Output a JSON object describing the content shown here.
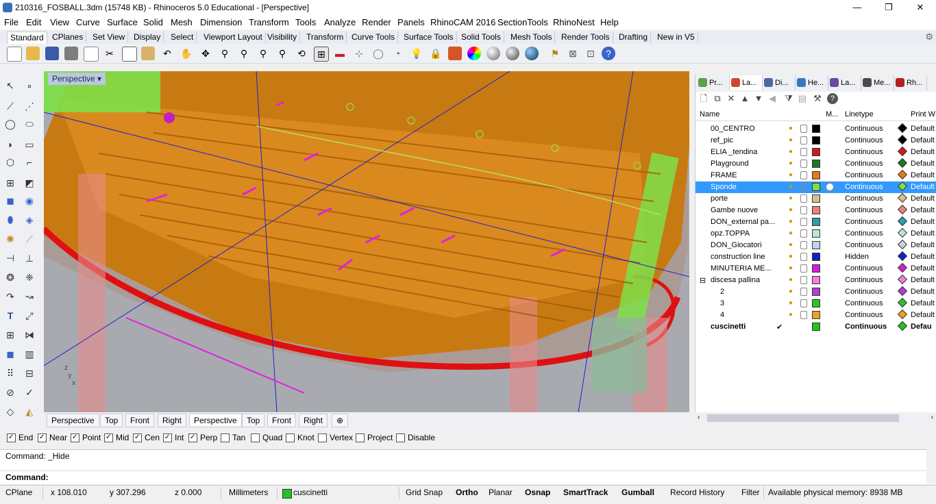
{
  "window": {
    "title": "210316_FOSBALL.3dm (15748 KB) - Rhinoceros 5.0 Educational - [Perspective]",
    "minimize": "—",
    "restore": "❐",
    "close": "✕"
  },
  "menu": [
    "File",
    "Edit",
    "View",
    "Curve",
    "Surface",
    "Solid",
    "Mesh",
    "Dimension",
    "Transform",
    "Tools",
    "Analyze",
    "Render",
    "Panels",
    "RhinoCAM 2016",
    "SectionTools",
    "RhinoNest",
    "Help"
  ],
  "toolbar_tabs": [
    "Standard",
    "CPlanes",
    "Set View",
    "Display",
    "Select",
    "Viewport Layout",
    "Visibility",
    "Transform",
    "Curve Tools",
    "Surface Tools",
    "Solid Tools",
    "Mesh Tools",
    "Render Tools",
    "Drafting",
    "New in V5"
  ],
  "toolbar_icons": [
    "new-icon",
    "open-icon",
    "save-icon",
    "print-icon",
    "import-icon",
    "cut-icon",
    "copy-icon",
    "paste-icon",
    "undo-icon",
    "pan-icon",
    "rotate-view-icon",
    "zoom-dynamic-icon",
    "zoom-window-icon",
    "zoom-extents-icon",
    "zoom-selected-icon",
    "rotate-icon",
    "four-views-icon",
    "car-icon",
    "grid-icon",
    "circle-icon",
    "light-icon",
    "lock-icon",
    "layer-icon",
    "color-wheel-icon",
    "shade-icon",
    "render-sphere-icon",
    "rendered-icon",
    "move-icon",
    "osnap-icon",
    "snap-icon",
    "help-icon"
  ],
  "viewport": {
    "label": "Perspective",
    "dropdown": "▾",
    "tabs": [
      "Perspective",
      "Top",
      "Front",
      "Right",
      "Perspective",
      "Top",
      "Front",
      "Right"
    ],
    "active_tab": 4,
    "add": "⊕"
  },
  "osnap": [
    {
      "label": "End",
      "checked": true
    },
    {
      "label": "Near",
      "checked": true
    },
    {
      "label": "Point",
      "checked": true
    },
    {
      "label": "Mid",
      "checked": true
    },
    {
      "label": "Cen",
      "checked": true
    },
    {
      "label": "Int",
      "checked": true
    },
    {
      "label": "Perp",
      "checked": true
    },
    {
      "label": "Tan",
      "checked": false
    },
    {
      "label": "Quad",
      "checked": false
    },
    {
      "label": "Knot",
      "checked": false
    },
    {
      "label": "Vertex",
      "checked": false
    },
    {
      "label": "Project",
      "checked": false
    },
    {
      "label": "Disable",
      "checked": false
    }
  ],
  "command": {
    "history": "Command: _Hide",
    "prompt": "Command:"
  },
  "status": {
    "cplane": "CPlane",
    "x": "x 108.010",
    "y": "y 307.296",
    "z": "z 0.000",
    "units": "Millimeters",
    "layer": "cuscinetti",
    "layer_color": "#22c322",
    "toggles": [
      {
        "label": "Grid Snap",
        "bold": false
      },
      {
        "label": "Ortho",
        "bold": true
      },
      {
        "label": "Planar",
        "bold": false
      },
      {
        "label": "Osnap",
        "bold": true
      },
      {
        "label": "SmartTrack",
        "bold": true
      },
      {
        "label": "Gumball",
        "bold": true
      },
      {
        "label": "Record History",
        "bold": false
      },
      {
        "label": "Filter",
        "bold": false
      }
    ],
    "memory": "Available physical memory: 8938 MB"
  },
  "panel": {
    "tabs": [
      {
        "label": "Pr...",
        "color": "#5ca04a"
      },
      {
        "label": "La...",
        "color": "#d0452e"
      },
      {
        "label": "Di...",
        "color": "#4a6aa3"
      },
      {
        "label": "He...",
        "color": "#3a76c4"
      },
      {
        "label": "La...",
        "color": "#6a4aa3"
      },
      {
        "label": "Me...",
        "color": "#4a4a4a"
      },
      {
        "label": "Rh...",
        "color": "#b22020"
      }
    ],
    "active_tab": 1,
    "layer_tools": [
      "new-layer-icon",
      "new-sublayer-icon",
      "delete-icon",
      "move-up-icon",
      "move-down-icon",
      "move-left-icon",
      "filter-icon",
      "copy-layer-icon",
      "tools-icon",
      "help-icon"
    ],
    "columns": {
      "name": "Name",
      "material": "M...",
      "linetype": "Linetype",
      "print": "Print W"
    },
    "layers": [
      {
        "name": "00_CENTRO",
        "color": "#000000",
        "linetype": "Continuous",
        "print": "Default"
      },
      {
        "name": "ref_pic",
        "color": "#000000",
        "linetype": "Continuous",
        "print": "Default"
      },
      {
        "name": "ELIA _tendina",
        "color": "#d11a1a",
        "linetype": "Continuous",
        "print": "Default"
      },
      {
        "name": "Playground",
        "color": "#1f7a1f",
        "linetype": "Continuous",
        "print": "Default"
      },
      {
        "name": "FRAME",
        "color": "#e07a20",
        "linetype": "Continuous",
        "print": "Default"
      },
      {
        "name": "Sponde",
        "color": "#7ee04a",
        "linetype": "Continuous",
        "print": "Default",
        "selected": true
      },
      {
        "name": "porte",
        "color": "#d8c08a",
        "linetype": "Continuous",
        "print": "Default"
      },
      {
        "name": "Gambe nuove",
        "color": "#e88080",
        "linetype": "Continuous",
        "print": "Default"
      },
      {
        "name": "DON_external pa...",
        "color": "#2a9fa8",
        "linetype": "Continuous",
        "print": "Default"
      },
      {
        "name": "opz.TOPPA",
        "color": "#b8e8c8",
        "linetype": "Continuous",
        "print": "Default"
      },
      {
        "name": "DON_Giocatori",
        "color": "#c8d0e8",
        "linetype": "Continuous",
        "print": "Default"
      },
      {
        "name": "construction line",
        "color": "#1020c8",
        "linetype": "Hidden",
        "print": "Default"
      },
      {
        "name": "MINUTERIA ME...",
        "color": "#d020d0",
        "linetype": "Continuous",
        "print": "Default"
      },
      {
        "name": "discesa pallina",
        "color": "#f080e0",
        "linetype": "Continuous",
        "print": "Default",
        "expand": "⊟"
      },
      {
        "name": "2",
        "color": "#b040d0",
        "linetype": "Continuous",
        "print": "Default",
        "indent": true
      },
      {
        "name": "3",
        "color": "#30c030",
        "linetype": "Continuous",
        "print": "Default",
        "indent": true
      },
      {
        "name": "4",
        "color": "#f0a020",
        "linetype": "Continuous",
        "print": "Default",
        "indent": true
      },
      {
        "name": "cuscinetti",
        "color": "#22c322",
        "linetype": "Continuous",
        "print": "Defau",
        "current": true,
        "check": "✔"
      }
    ]
  }
}
